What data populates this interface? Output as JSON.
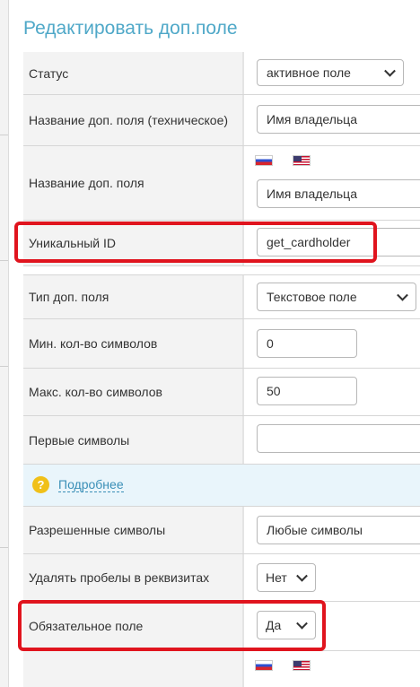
{
  "title": "Редактировать доп.поле",
  "rows": {
    "status": {
      "label": "Статус",
      "value": "активное поле"
    },
    "tech_name": {
      "label": "Название доп. поля (техническое)",
      "value": "Имя владельца"
    },
    "name": {
      "label": "Название доп. поля",
      "value": "Имя владельца",
      "flags": [
        "flag-ru-icon",
        "flag-us-icon"
      ]
    },
    "unique_id": {
      "label": "Уникальный ID",
      "value": "get_cardholder"
    },
    "type": {
      "label": "Тип доп. поля",
      "value": "Текстовое поле"
    },
    "min_chars": {
      "label": "Мин. кол-во символов",
      "value": "0"
    },
    "max_chars": {
      "label": "Макс. кол-во символов",
      "value": "50"
    },
    "first_chars": {
      "label": "Первые символы",
      "value": ""
    },
    "allowed_chars": {
      "label": "Разрешенные символы",
      "value": "Любые символы"
    },
    "strip_spaces": {
      "label": "Удалять пробелы в реквизитах",
      "value": "Нет"
    },
    "required": {
      "label": "Обязательное поле",
      "value": "Да"
    },
    "last": {
      "label": "",
      "flags": [
        "flag-ru-icon",
        "flag-us-icon"
      ]
    }
  },
  "info": {
    "link": "Подробнее",
    "icon": "question-icon",
    "icon_glyph": "?"
  },
  "colors": {
    "accent": "#4fa8c8",
    "highlight": "#e0141e",
    "info_bg": "#e9f5fb",
    "info_icon": "#f0c019"
  }
}
